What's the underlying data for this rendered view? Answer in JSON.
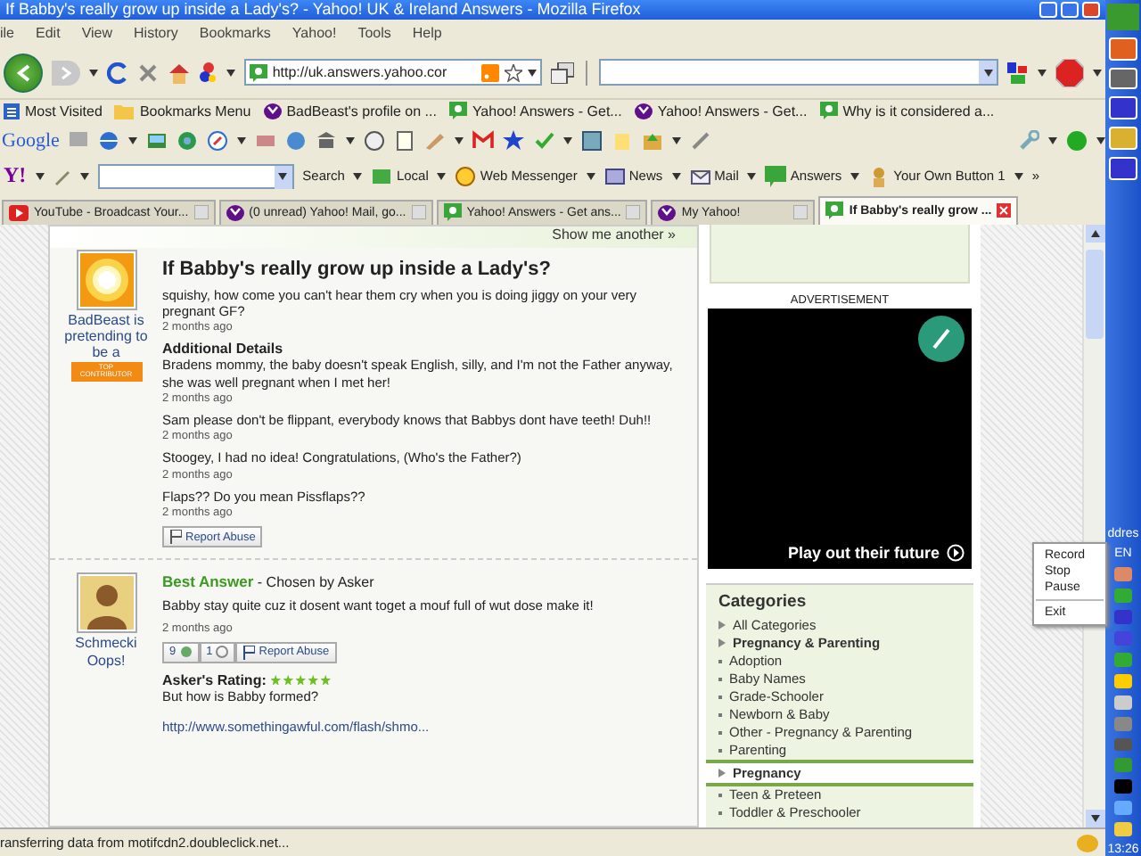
{
  "window": {
    "title": "If Babby's really grow up inside a Lady's? - Yahoo! UK & Ireland Answers - Mozilla Firefox"
  },
  "menu": [
    "ile",
    "Edit",
    "View",
    "History",
    "Bookmarks",
    "Yahoo!",
    "Tools",
    "Help"
  ],
  "nav": {
    "url": "http://uk.answers.yahoo.cor"
  },
  "bookmarks": [
    {
      "label": "Most Visited",
      "kind": "list"
    },
    {
      "label": "Bookmarks Menu",
      "kind": "folder"
    },
    {
      "label": "BadBeast's profile on ...",
      "kind": "yahoo"
    },
    {
      "label": "Yahoo! Answers - Get...",
      "kind": "answers"
    },
    {
      "label": "Yahoo! Answers - Get...",
      "kind": "yahoo"
    },
    {
      "label": "Why is it considered a...",
      "kind": "answers"
    }
  ],
  "google_toolbar": {
    "logo": "Google"
  },
  "yahoo_toolbar": {
    "logo": "Y!",
    "items": [
      "Search",
      "Local",
      "Web Messenger",
      "News",
      "Mail",
      "Answers",
      "Your Own Button 1"
    ],
    "more": "»"
  },
  "tabs": [
    {
      "label": "YouTube - Broadcast Your...",
      "kind": "video",
      "selected": false
    },
    {
      "label": "(0 unread) Yahoo! Mail, go...",
      "kind": "yahoo",
      "selected": false
    },
    {
      "label": "Yahoo! Answers - Get ans...",
      "kind": "answers",
      "selected": false
    },
    {
      "label": "My Yahoo!",
      "kind": "yahoo",
      "selected": false
    },
    {
      "label": "If Babby's really grow ...",
      "kind": "answers",
      "selected": true
    }
  ],
  "show_another": "Show me another »",
  "question": {
    "asker": "BadBeast is pretending to be a",
    "badge": "TOP CONTRIBUTOR",
    "title": "If Babby's really grow up inside a Lady's?",
    "body": "squishy, how come you can't hear them cry when you is doing jiggy on your very pregnant GF?",
    "time": "2 months ago",
    "details_heading": "Additional Details",
    "details": [
      {
        "text": "Bradens mommy, the baby doesn't speak English, silly, and I'm not the Father anyway, she was well pregnant when I met her!",
        "time": "2 months ago"
      },
      {
        "text": "Sam please don't be flippant, everybody knows that Babbys dont have teeth! Duh!!",
        "time": "2 months ago"
      },
      {
        "text": "Stoogey, I had no idea! Congratulations, (Who's the Father?)",
        "time": "2 months ago"
      },
      {
        "text": "Flaps?? Do you mean Pissflaps??",
        "time": "2 months ago"
      }
    ],
    "report": "Report Abuse"
  },
  "best_answer": {
    "label": "Best Answer",
    "chosen": "- Chosen by Asker",
    "user": "Schmecki",
    "user_status": "Oops!",
    "text": "Babby stay quite cuz it dosent want toget a mouf full of wut dose make it!",
    "time": "2 months ago",
    "thumbs_up": "9",
    "thumbs_down": "1",
    "report": "Report Abuse",
    "rating_label": "Asker's Rating:",
    "stars": 5,
    "comment": "But how is Babby formed?",
    "link": "http://www.somethingawful.com/flash/shmo..."
  },
  "sidebar": {
    "ad_label": "ADVERTISEMENT",
    "ad_text": "Play out their future",
    "categories_title": "Categories",
    "categories": [
      {
        "label": "All Categories",
        "kind": "all",
        "selected": false
      },
      {
        "label": "Pregnancy & Parenting",
        "kind": "parent",
        "selected": false
      },
      {
        "label": "Adoption",
        "kind": "sub",
        "selected": false
      },
      {
        "label": "Baby Names",
        "kind": "sub",
        "selected": false
      },
      {
        "label": "Grade-Schooler",
        "kind": "sub",
        "selected": false
      },
      {
        "label": "Newborn & Baby",
        "kind": "sub",
        "selected": false
      },
      {
        "label": "Other - Pregnancy & Parenting",
        "kind": "sub",
        "selected": false
      },
      {
        "label": "Parenting",
        "kind": "sub",
        "selected": false
      },
      {
        "label": "Pregnancy",
        "kind": "sub",
        "selected": true
      },
      {
        "label": "Teen & Preteen",
        "kind": "sub",
        "selected": false
      },
      {
        "label": "Toddler & Preschooler",
        "kind": "sub",
        "selected": false
      }
    ]
  },
  "context_menu": [
    "Record",
    "Stop",
    "Pause",
    "Exit"
  ],
  "status_bar": "ransferring data from motifcdn2.doubleclick.net...",
  "taskbar": {
    "address": "ddres",
    "language": "EN",
    "clock": "13:26"
  }
}
